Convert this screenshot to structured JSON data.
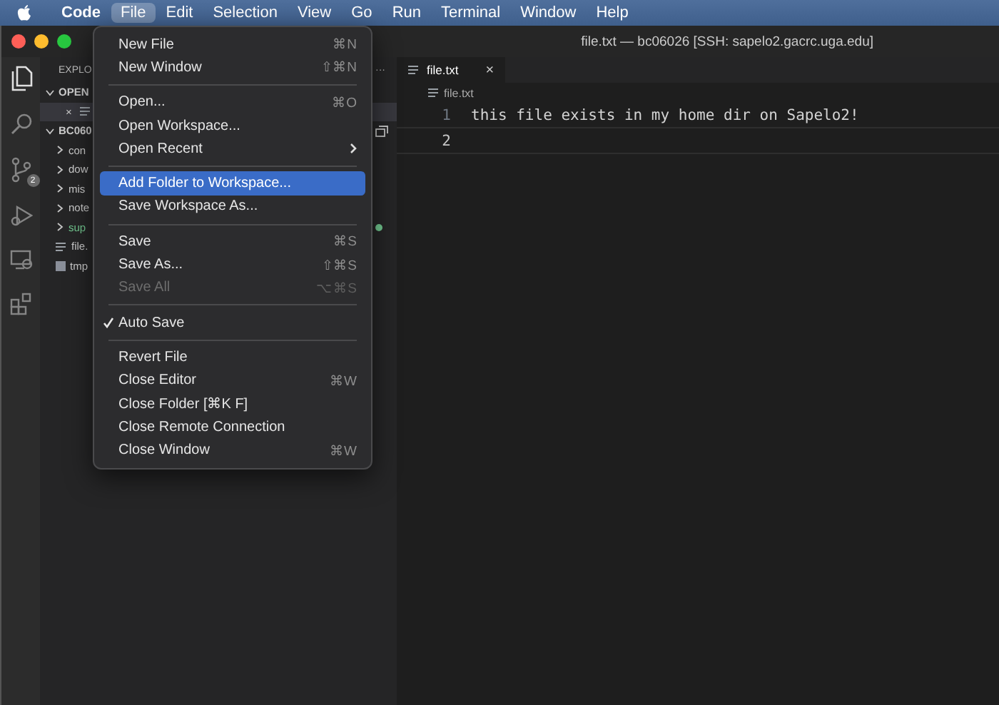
{
  "menubar": [
    {
      "label": "Code",
      "selected": false,
      "bold": true
    },
    {
      "label": "File",
      "selected": true,
      "bold": false
    },
    {
      "label": "Edit",
      "selected": false,
      "bold": false
    },
    {
      "label": "Selection",
      "selected": false,
      "bold": false
    },
    {
      "label": "View",
      "selected": false,
      "bold": false
    },
    {
      "label": "Go",
      "selected": false,
      "bold": false
    },
    {
      "label": "Run",
      "selected": false,
      "bold": false
    },
    {
      "label": "Terminal",
      "selected": false,
      "bold": false
    },
    {
      "label": "Window",
      "selected": false,
      "bold": false
    },
    {
      "label": "Help",
      "selected": false,
      "bold": false
    }
  ],
  "window": {
    "title": "file.txt — bc06026 [SSH: sapelo2.gacrc.uga.edu]"
  },
  "activity_bar": [
    {
      "kind": "files",
      "selected": true
    },
    {
      "kind": "search",
      "selected": false
    },
    {
      "kind": "scm",
      "selected": false,
      "badge": "2"
    },
    {
      "kind": "debug",
      "selected": false
    },
    {
      "kind": "remote",
      "selected": false
    },
    {
      "kind": "extensions",
      "selected": false
    }
  ],
  "sidebar": {
    "title": "EXPLO",
    "more": "···",
    "open_editors": {
      "label": "OPEN",
      "expanded": true,
      "items": [
        {
          "close": "×"
        }
      ]
    },
    "folder": {
      "label": "BC060",
      "expanded": true,
      "children": [
        {
          "kind": "folder",
          "label": "con",
          "expanded": false,
          "color": "#cccccc"
        },
        {
          "kind": "folder",
          "label": "dow",
          "expanded": false,
          "color": "#cccccc"
        },
        {
          "kind": "folder",
          "label": "mis",
          "expanded": false,
          "color": "#cccccc"
        },
        {
          "kind": "folder",
          "label": "note",
          "expanded": false,
          "color": "#cccccc"
        },
        {
          "kind": "folder",
          "label": "sup",
          "expanded": false,
          "color": "#73c991"
        },
        {
          "kind": "file",
          "label": "file.",
          "color": "#cccccc"
        },
        {
          "kind": "binary",
          "label": "tmp",
          "color": "#cccccc"
        }
      ]
    }
  },
  "file_menu": [
    {
      "kind": "item",
      "label": "New File",
      "shortcut": "⌘N",
      "selected": false,
      "disabled": false,
      "checked": false
    },
    {
      "kind": "item",
      "label": "New Window",
      "shortcut": "⇧⌘N",
      "selected": false,
      "disabled": false,
      "checked": false
    },
    {
      "kind": "separator"
    },
    {
      "kind": "item",
      "label": "Open...",
      "shortcut": "⌘O",
      "selected": false,
      "disabled": false,
      "checked": false
    },
    {
      "kind": "item",
      "label": "Open Workspace...",
      "selected": false,
      "disabled": false,
      "checked": false
    },
    {
      "kind": "submenu",
      "label": "Open Recent",
      "selected": false,
      "disabled": false,
      "checked": false
    },
    {
      "kind": "separator"
    },
    {
      "kind": "item",
      "label": "Add Folder to Workspace...",
      "selected": true,
      "disabled": false,
      "checked": false
    },
    {
      "kind": "item",
      "label": "Save Workspace As...",
      "selected": false,
      "disabled": false,
      "checked": false
    },
    {
      "kind": "separator"
    },
    {
      "kind": "item",
      "label": "Save",
      "shortcut": "⌘S",
      "selected": false,
      "disabled": false,
      "checked": false
    },
    {
      "kind": "item",
      "label": "Save As...",
      "shortcut": "⇧⌘S",
      "selected": false,
      "disabled": false,
      "checked": false
    },
    {
      "kind": "item",
      "label": "Save All",
      "shortcut": "⌥⌘S",
      "selected": false,
      "disabled": true,
      "checked": false
    },
    {
      "kind": "separator"
    },
    {
      "kind": "item",
      "label": "Auto Save",
      "selected": false,
      "disabled": false,
      "checked": true
    },
    {
      "kind": "separator"
    },
    {
      "kind": "item",
      "label": "Revert File",
      "selected": false,
      "disabled": false,
      "checked": false
    },
    {
      "kind": "item",
      "label": "Close Editor",
      "shortcut": "⌘W",
      "selected": false,
      "disabled": false,
      "checked": false
    },
    {
      "kind": "item",
      "label": "Close Folder [⌘K F]",
      "selected": false,
      "disabled": false,
      "checked": false
    },
    {
      "kind": "item",
      "label": "Close Remote Connection",
      "selected": false,
      "disabled": false,
      "checked": false
    },
    {
      "kind": "item",
      "label": "Close Window",
      "shortcut": "⌘W",
      "selected": false,
      "disabled": false,
      "checked": false
    }
  ],
  "editor": {
    "tabs": [
      {
        "label": "file.txt",
        "close": "×",
        "selected": true
      }
    ],
    "breadcrumb": "file.txt",
    "lines": [
      {
        "number": "1",
        "text": "this file exists in my home dir on Sapelo2!",
        "current": false
      },
      {
        "number": "2",
        "current": true
      }
    ]
  }
}
